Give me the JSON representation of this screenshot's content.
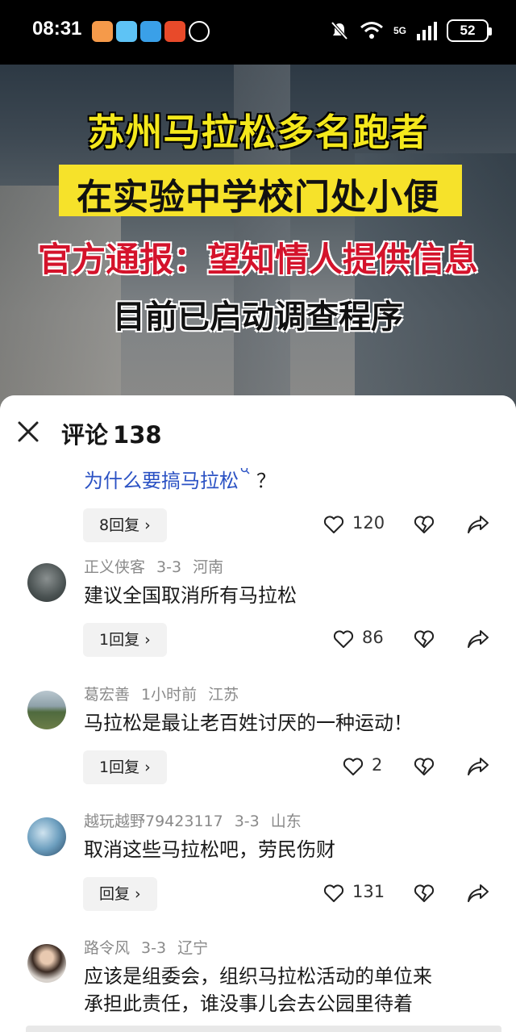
{
  "status_bar": {
    "time": "08:31",
    "network": "5G",
    "battery": "52"
  },
  "video": {
    "headline_1": "苏州马拉松多名跑者",
    "headline_2": "在实验中学校门处小便",
    "headline_3": "官方通报：望知情人提供信息",
    "headline_4": "目前已启动调查程序"
  },
  "panel": {
    "title": "评论",
    "count": "138"
  },
  "comments": [
    {
      "text": "为什么要搞马拉松",
      "text_suffix": "？",
      "reply": "8回复",
      "likes": "120"
    },
    {
      "user": "正义侠客",
      "date": "3-3",
      "location": "河南",
      "text": "建议全国取消所有马拉松",
      "reply": "1回复",
      "likes": "86"
    },
    {
      "user": "葛宏善",
      "date": "1小时前",
      "location": "江苏",
      "text": "马拉松是最让老百姓讨厌的一种运动！",
      "reply": "1回复",
      "likes": "2"
    },
    {
      "user": "越玩越野79423117",
      "date": "3-3",
      "location": "山东",
      "text": "取消这些马拉松吧，劳民伤财",
      "reply": "回复",
      "likes": "131"
    },
    {
      "user": "路令风",
      "date": "3-3",
      "location": "辽宁",
      "text": "应该是组委会，组织马拉松活动的单位来",
      "text_2": "承担此责任，谁没事儿会去公园里待着"
    }
  ],
  "colors": {
    "headline_yellow": "#f4e81c",
    "headline_red": "#d4132b",
    "link_blue": "#2b52c4"
  }
}
